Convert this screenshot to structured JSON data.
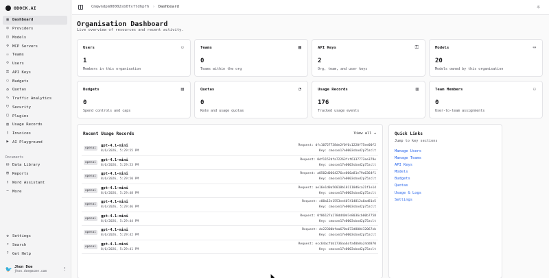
{
  "app": {
    "name": "ODOCK.AI"
  },
  "sidebar": {
    "items": [
      {
        "label": "Dashboard",
        "icon": "▦"
      },
      {
        "label": "Providers",
        "icon": "◎"
      },
      {
        "label": "Models",
        "icon": "◫"
      },
      {
        "label": "MCP Servers",
        "icon": "⚙"
      },
      {
        "label": "Teams",
        "icon": "⚇"
      },
      {
        "label": "Users",
        "icon": "☺"
      },
      {
        "label": "API Keys",
        "icon": "⚿"
      },
      {
        "label": "Budgets",
        "icon": "▭"
      },
      {
        "label": "Quotas",
        "icon": "◔"
      },
      {
        "label": "Traffic Analytics",
        "icon": "∿"
      },
      {
        "label": "Security",
        "icon": "⛉"
      },
      {
        "label": "Plugins",
        "icon": "⬡"
      },
      {
        "label": "Usage Records",
        "icon": "▤"
      },
      {
        "label": "Invoices",
        "icon": "▯"
      },
      {
        "label": "AI Playground",
        "icon": "▶"
      }
    ],
    "docs_label": "Documents",
    "docs": [
      {
        "label": "Data Library",
        "icon": "⛁"
      },
      {
        "label": "Reports",
        "icon": "▤"
      },
      {
        "label": "Word Assistant",
        "icon": "▯"
      },
      {
        "label": "More",
        "icon": "⋯"
      }
    ],
    "bottom": [
      {
        "label": "Settings",
        "icon": "⚙"
      },
      {
        "label": "Search",
        "icon": "⌕"
      },
      {
        "label": "Get Help",
        "icon": "?"
      }
    ],
    "user": {
      "name": "Jhon Doe",
      "email": "jhon.doe@acme.com"
    }
  },
  "topbar": {
    "breadcrumb": [
      "Cmqwndpm00002sb0fxftdhpfh",
      "Dashboard"
    ]
  },
  "main": {
    "title": "Organisation Dashboard",
    "subtitle": "Live overview of resources and recent activity.",
    "cards": [
      {
        "title": "Users",
        "value": "1",
        "desc": "Members in this organisation",
        "icon": "⚇"
      },
      {
        "title": "Teams",
        "value": "0",
        "desc": "Teams within the org",
        "icon": "▦"
      },
      {
        "title": "API Keys",
        "value": "2",
        "desc": "Org, team, and user keys",
        "icon": "⚿"
      },
      {
        "title": "Models",
        "value": "20",
        "desc": "Models owned by this organisation",
        "icon": "▭"
      },
      {
        "title": "Budgets",
        "value": "0",
        "desc": "Spend controls and caps",
        "icon": "▤"
      },
      {
        "title": "Quotas",
        "value": "0",
        "desc": "Rate and usage quotas",
        "icon": "◔"
      },
      {
        "title": "Usage Records",
        "value": "176",
        "desc": "Tracked usage events",
        "icon": "▥"
      },
      {
        "title": "Team Members",
        "value": "0",
        "desc": "User-to-team assignments",
        "icon": "⚇"
      }
    ],
    "recent": {
      "title": "Recent Usage Records",
      "view_all": "View all →",
      "records": [
        {
          "provider": "openai",
          "model": "gpt-4.1-mini",
          "time": "8/6/2026, 5:29:55 PM",
          "request": "Request: dfc10727738de2f0f6c1220f75ee00f2",
          "key": "Key: cmosxn17e0003sbod2p75zclt"
        },
        {
          "provider": "openai",
          "model": "gpt-4.1-mini",
          "time": "8/6/2026, 5:29:53 PM",
          "request": "Request: 0df1152dfa72263fcf6137772ee379e",
          "key": "Key: cmosxn17e0003sbod2p75zclt"
        },
        {
          "provider": "openai",
          "model": "gpt-4.1-mini",
          "time": "8/6/2026, 5:29:50 PM",
          "request": "Request: a0502d0664276ce066a81e79a6364f1",
          "key": "Key: cmosxn17e0003sbod2p75zclt"
        },
        {
          "provider": "openai",
          "model": "gpt-4.1-mini",
          "time": "8/6/2026, 5:29:48 PM",
          "request": "Request: ae16e1d0a56010b181110d6ca21f1e14",
          "key": "Key: cmosxn17e0003sbod2p75zclt"
        },
        {
          "provider": "openai",
          "model": "gpt-4.1-mini",
          "time": "8/6/2026, 5:29:46 PM",
          "request": "Request: c08a13e1553ee407414812a8ad81e5",
          "key": "Key: cmosxn17e0003sbod2p75zclt"
        },
        {
          "provider": "openai",
          "model": "gpt-4.1-mini",
          "time": "8/6/2026, 5:29:44 PM",
          "request": "Request: 0f06127a278dd40d7e8036cb00b7758",
          "key": "Key: cmosxn17e0003sbod2p75zclt"
        },
        {
          "provider": "openai",
          "model": "gpt-4.1-mini",
          "time": "8/6/2026, 5:29:42 PM",
          "request": "Request: de22300bfaa670e072d800432067eb",
          "key": "Key: cmosxn17e0003sbod2p75zclt"
        },
        {
          "provider": "openai",
          "model": "gpt-4.1-mini",
          "time": "8/6/2026, 5:29:41 PM",
          "request": "Request: ecc64acfbb1736aa6afa40b0a24dd870",
          "key": "Key: cmosxn17e0003sbod2p75zclt"
        }
      ]
    },
    "quick_links": {
      "title": "Quick Links",
      "subtitle": "Jump to key sections",
      "links": [
        "Manage Users",
        "Manage Teams",
        "API Keys",
        "Models",
        "Budgets",
        "Quotas",
        "Usage & Logs",
        "Settings"
      ]
    }
  },
  "colors": {
    "link": "#2563eb",
    "active_nav": "#e4e4e7",
    "border": "#e4e4e7"
  }
}
